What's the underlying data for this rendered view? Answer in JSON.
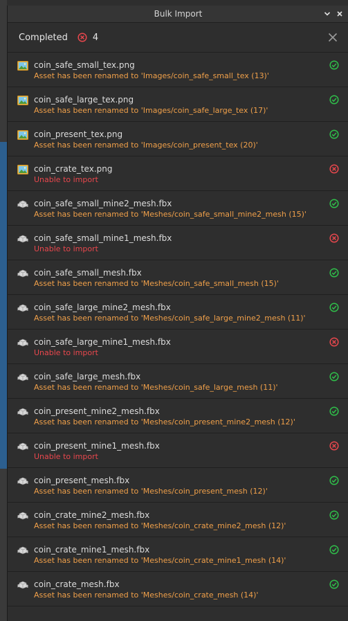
{
  "window": {
    "title": "Bulk Import"
  },
  "status_bar": {
    "completed_label": "Completed",
    "error_count": "4"
  },
  "colors": {
    "ok": "#2fbf4a",
    "error": "#e8474d",
    "rename_message": "#f0a04a",
    "error_message": "#e8474d"
  },
  "items": [
    {
      "name": "coin_safe_small_tex.png",
      "message": "Asset has been renamed to 'Images/coin_safe_small_tex (13)'",
      "type": "image-icon",
      "status": "ok"
    },
    {
      "name": "coin_safe_large_tex.png",
      "message": "Asset has been renamed to 'Images/coin_safe_large_tex (17)'",
      "type": "image-icon",
      "status": "ok"
    },
    {
      "name": "coin_present_tex.png",
      "message": "Asset has been renamed to 'Images/coin_present_tex (20)'",
      "type": "image-icon",
      "status": "ok"
    },
    {
      "name": "coin_crate_tex.png",
      "message": "Unable to import",
      "type": "image-icon",
      "status": "error"
    },
    {
      "name": "coin_safe_small_mine2_mesh.fbx",
      "message": "Asset has been renamed to 'Meshes/coin_safe_small_mine2_mesh (15)'",
      "type": "mesh-icon",
      "status": "ok"
    },
    {
      "name": "coin_safe_small_mine1_mesh.fbx",
      "message": "Unable to import",
      "type": "mesh-icon",
      "status": "error"
    },
    {
      "name": "coin_safe_small_mesh.fbx",
      "message": "Asset has been renamed to 'Meshes/coin_safe_small_mesh (15)'",
      "type": "mesh-icon",
      "status": "ok"
    },
    {
      "name": "coin_safe_large_mine2_mesh.fbx",
      "message": "Asset has been renamed to 'Meshes/coin_safe_large_mine2_mesh (11)'",
      "type": "mesh-icon",
      "status": "ok"
    },
    {
      "name": "coin_safe_large_mine1_mesh.fbx",
      "message": "Unable to import",
      "type": "mesh-icon",
      "status": "error"
    },
    {
      "name": "coin_safe_large_mesh.fbx",
      "message": "Asset has been renamed to 'Meshes/coin_safe_large_mesh (11)'",
      "type": "mesh-icon",
      "status": "ok"
    },
    {
      "name": "coin_present_mine2_mesh.fbx",
      "message": "Asset has been renamed to 'Meshes/coin_present_mine2_mesh (12)'",
      "type": "mesh-icon",
      "status": "ok"
    },
    {
      "name": "coin_present_mine1_mesh.fbx",
      "message": "Unable to import",
      "type": "mesh-icon",
      "status": "error"
    },
    {
      "name": "coin_present_mesh.fbx",
      "message": "Asset has been renamed to 'Meshes/coin_present_mesh (12)'",
      "type": "mesh-icon",
      "status": "ok"
    },
    {
      "name": "coin_crate_mine2_mesh.fbx",
      "message": "Asset has been renamed to 'Meshes/coin_crate_mine2_mesh (12)'",
      "type": "mesh-icon",
      "status": "ok"
    },
    {
      "name": "coin_crate_mine1_mesh.fbx",
      "message": "Asset has been renamed to 'Meshes/coin_crate_mine1_mesh (14)'",
      "type": "mesh-icon",
      "status": "ok"
    },
    {
      "name": "coin_crate_mesh.fbx",
      "message": "Asset has been renamed to 'Meshes/coin_crate_mesh (14)'",
      "type": "mesh-icon",
      "status": "ok"
    }
  ]
}
